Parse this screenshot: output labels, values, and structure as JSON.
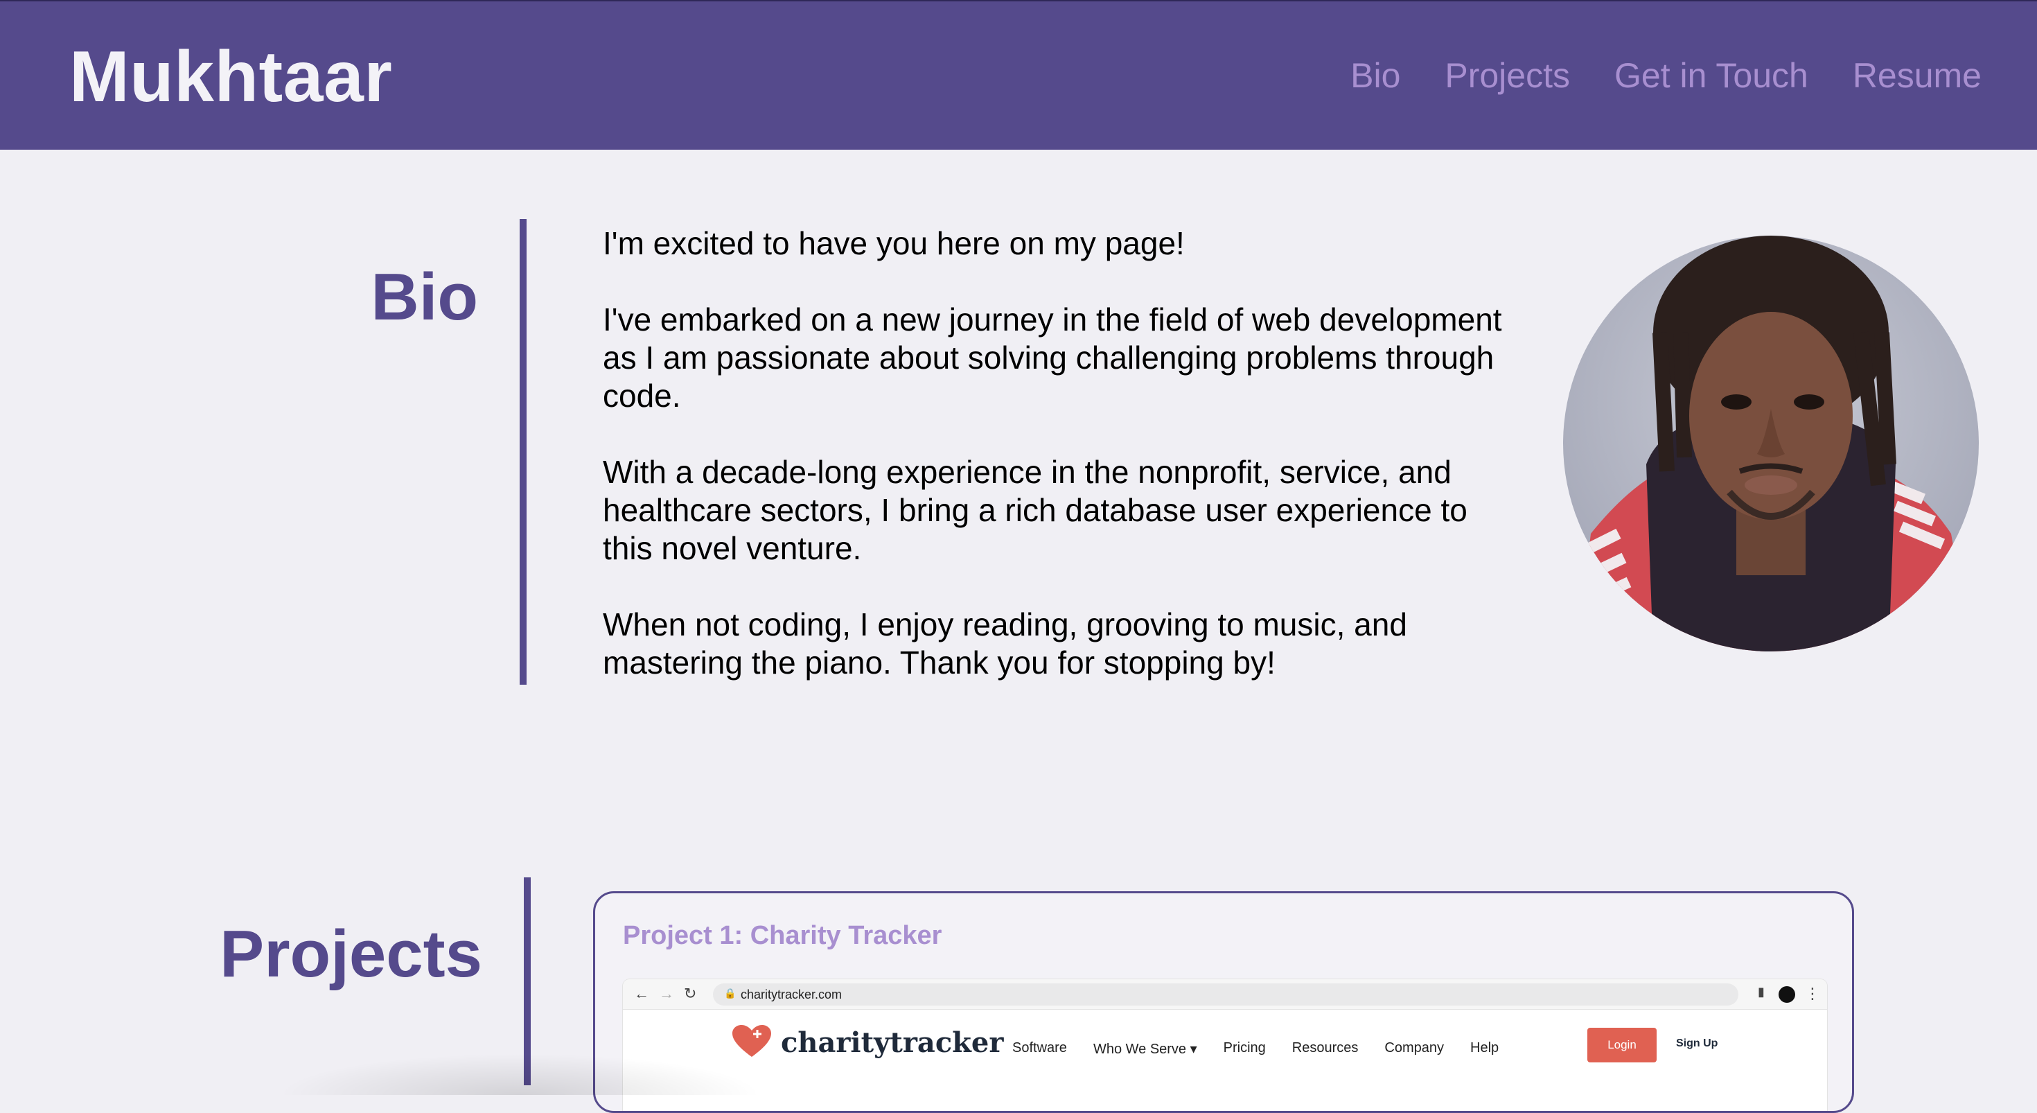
{
  "header": {
    "brand": "Mukhtaar",
    "nav": [
      "Bio",
      "Projects",
      "Get in Touch",
      "Resume"
    ]
  },
  "bio": {
    "title": "Bio",
    "paragraphs": [
      "I'm excited to have you here on my page!",
      "I've embarked on a new journey in the field of web development as I am passionate about solving challenging problems through code.",
      "With a decade-long experience in the nonprofit, service, and healthcare sectors, I bring a rich database user experience to this novel venture.",
      "When not coding, I enjoy reading, grooving to music, and mastering the piano. Thank you for stopping by!"
    ]
  },
  "projects": {
    "title": "Projects",
    "items": [
      {
        "title": "Project 1: Charity Tracker",
        "screenshot": {
          "url": "charitytracker.com",
          "logo": "charitytracker",
          "links": [
            "Software",
            "Who We Serve ▾",
            "Pricing",
            "Resources",
            "Company",
            "Help"
          ],
          "login": "Login",
          "signup": "Sign Up"
        }
      }
    ]
  },
  "colors": {
    "primary": "#554a8c",
    "accent": "#a88fd0",
    "background": "#f0eff4",
    "cta": "#e06152"
  }
}
